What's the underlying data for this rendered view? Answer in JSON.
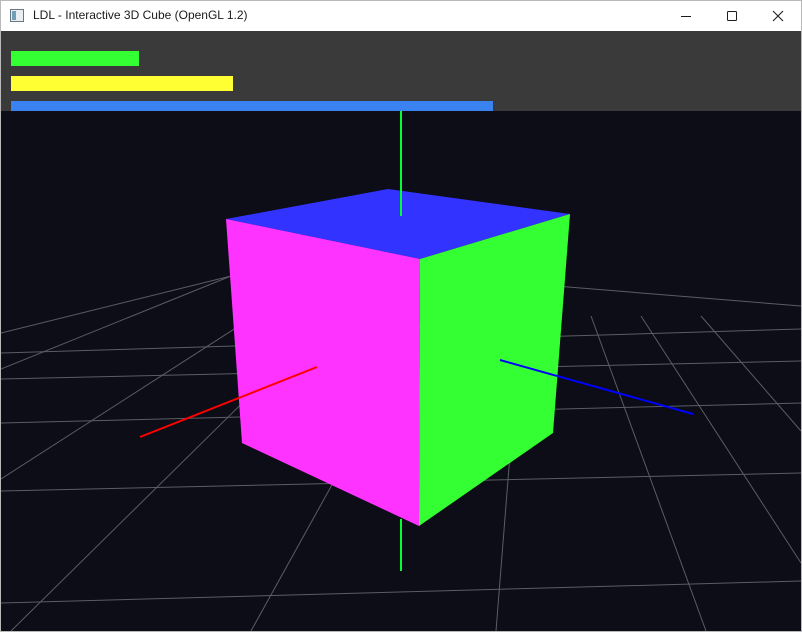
{
  "window": {
    "title": "LDL - Interactive 3D Cube (OpenGL 1.2)",
    "icon": "app-window-icon",
    "controls": [
      "minimize-icon",
      "maximize-icon",
      "close-icon"
    ]
  },
  "hud": {
    "bars": [
      {
        "name": "green-bar",
        "color": "#33ff33"
      },
      {
        "name": "yellow-bar",
        "color": "#ffff33"
      },
      {
        "name": "blue-bar",
        "color": "#3a82f0"
      }
    ]
  },
  "scene": {
    "background": "#0c0d16",
    "grid_color": "#5a5c66",
    "axes": {
      "x": "#ff0000",
      "y": "#00ff33",
      "z": "#0000ff"
    },
    "cube_faces": {
      "top": "#3333ff",
      "front": "#ff33ff",
      "side": "#33ff33"
    }
  }
}
